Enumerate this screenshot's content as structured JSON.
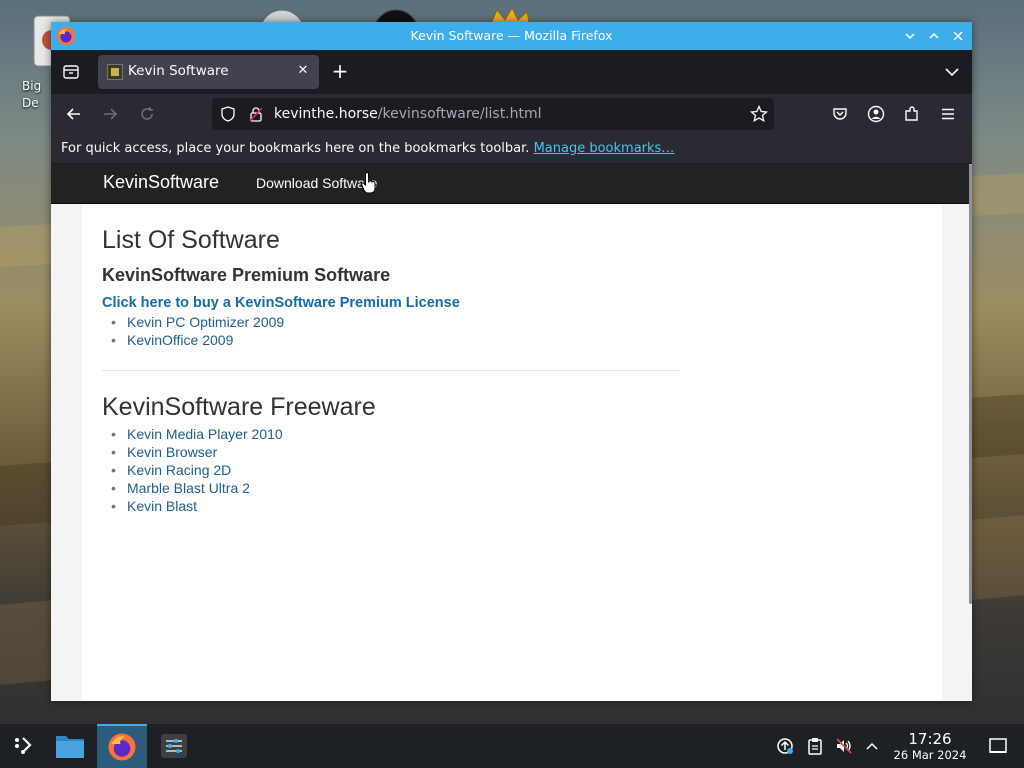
{
  "desktop": {
    "icon_label": "Big\nDe"
  },
  "window": {
    "title": "Kevin Software — Mozilla Firefox"
  },
  "tabs": [
    {
      "title": "Kevin Software",
      "active": true
    }
  ],
  "urlbar": {
    "domain": "kevinthe.horse",
    "path": "/kevinsoftware/list.html"
  },
  "bookmarks_bar": {
    "message": "For quick access, place your bookmarks here on the bookmarks toolbar.",
    "link": "Manage bookmarks…"
  },
  "site": {
    "brand": "KevinSoftware",
    "nav_link": "Download Software",
    "page_title": "List Of Software",
    "premium_heading": "KevinSoftware Premium Software",
    "buy_link": "Click here to buy a KevinSoftware Premium License",
    "premium_items": [
      "Kevin PC Optimizer 2009",
      "KevinOffice 2009"
    ],
    "freeware_heading": "KevinSoftware Freeware",
    "freeware_items": [
      "Kevin Media Player 2010",
      "Kevin Browser",
      "Kevin Racing 2D",
      "Marble Blast Ultra 2",
      "Kevin Blast"
    ]
  },
  "taskbar": {
    "time": "17:26",
    "date": "26 Mar 2024"
  },
  "colors": {
    "titlebar": "#3daee9",
    "link": "#1f5f8f",
    "bookmark_link": "#45c7e6"
  }
}
